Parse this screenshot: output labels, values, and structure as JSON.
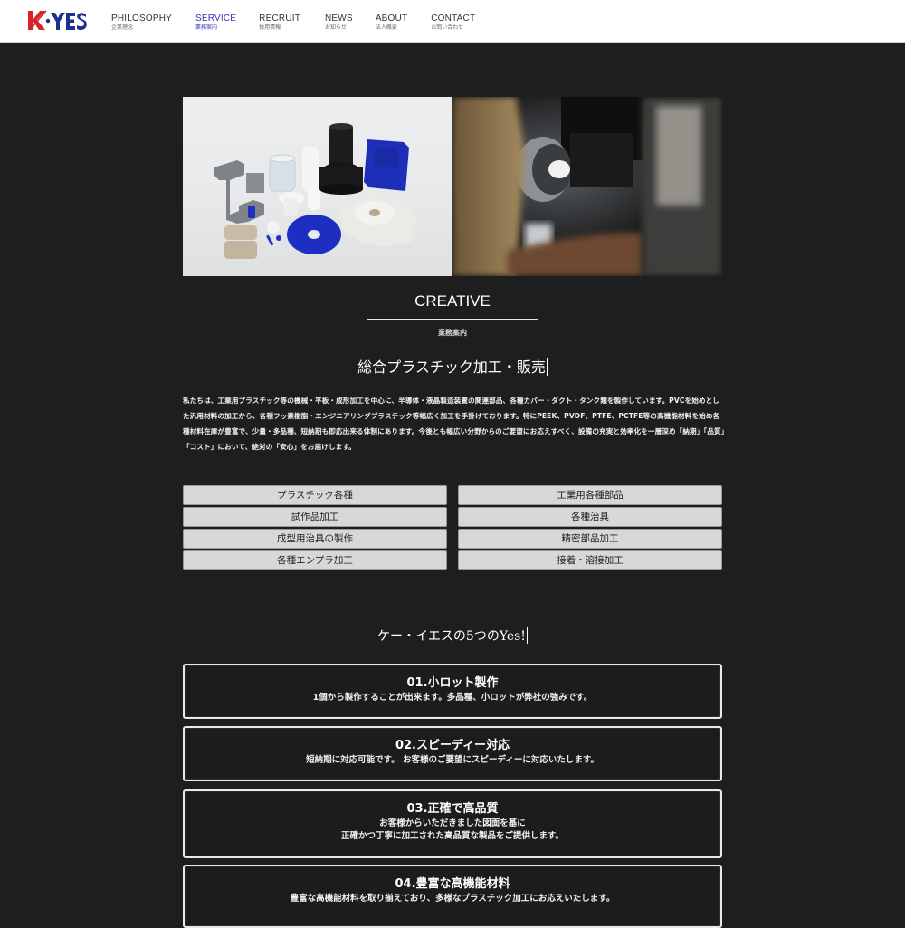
{
  "header": {
    "logo": {
      "text_k": "K",
      "text_rest": "YES",
      "colors": {
        "k": "#d8232a",
        "yes": "#1e2f8f"
      }
    },
    "nav": [
      {
        "en": "PHILOSOPHY",
        "ja": "企業理念",
        "active": false
      },
      {
        "en": "SERVICE",
        "ja": "業務案内",
        "active": true
      },
      {
        "en": "RECRUIT",
        "ja": "採用情報",
        "active": false
      },
      {
        "en": "NEWS",
        "ja": "お知らせ",
        "active": false
      },
      {
        "en": "ABOUT",
        "ja": "法人概要",
        "active": false
      },
      {
        "en": "CONTACT",
        "ja": "お問い合わせ",
        "active": false
      }
    ],
    "active_color": "#3a32b8"
  },
  "hero": {
    "left_image": "plastic-parts-photo",
    "right_image": "lathe-machining-photo"
  },
  "section": {
    "title": "CREATIVE",
    "subtitle": "業務案内",
    "heading": "総合プラスチック加工・販売",
    "intro": "私たちは、工業用プラスチック等の機械・平板・成形加工を中心に、半導体・液晶製造装置の関連部品、各種カバー・ダクト・タンク類を製作しています。PVCを始めとした汎用材料の加工から、各種フッ素樹脂・エンジニアリングプラスチック等幅広く加工を手掛けております。特にPEEK、PVDF、PTFE、PCTFE等の高機能材料を始め各種材料在庫が豊富で、少量・多品種、短納期も即応出来る体制にあります。今後とも幅広い分野からのご要望にお応えすべく、設備の充実と効率化を一層深め「納期」「品質」「コスト」において、絶対の「安心」をお届けします。"
  },
  "services": [
    "プラスチック各種",
    "工業用各種部品",
    "試作品加工",
    "各種治具",
    "成型用治具の製作",
    "精密部品加工",
    "各種エンプラ加工",
    "接着・溶接加工"
  ],
  "five_yes": {
    "heading": "ケー・イエスの5つのYes!",
    "items": [
      {
        "title": "01.小ロット製作",
        "desc": [
          "1個から製作することが出来ます。多品種、小ロットが弊社の強みです。"
        ]
      },
      {
        "title": "02.スピーディー対応",
        "desc": [
          "短納期に対応可能です。 お客様のご要望にスピーディーに対応いたします。"
        ]
      },
      {
        "title": "03.正確で高品質",
        "desc": [
          "お客様からいただきました図面を基に",
          "正確かつ丁寧に加工された高品質な製品をご提供します。"
        ]
      },
      {
        "title": "04.豊富な高機能材料",
        "desc": [
          "豊富な高機能材料を取り揃えており、多様なプラスチック加工にお応えいたします。"
        ]
      }
    ]
  }
}
